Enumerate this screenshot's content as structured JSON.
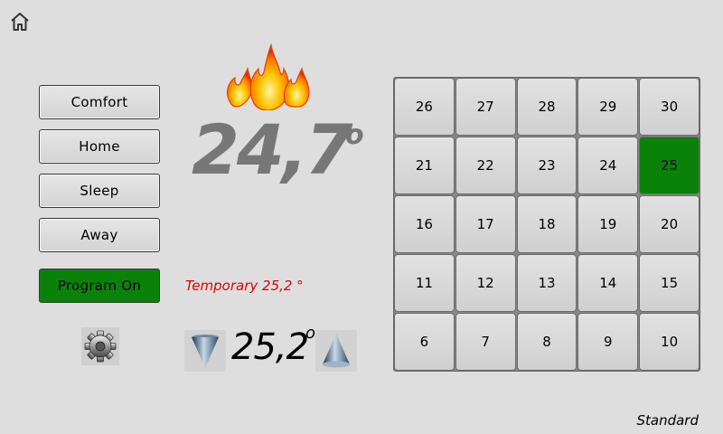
{
  "header": {
    "home_icon": "home-icon"
  },
  "modes": {
    "comfort": "Comfort",
    "home": "Home",
    "sleep": "Sleep",
    "away": "Away",
    "program": "Program On"
  },
  "status": {
    "heating_icon": "flame-icon",
    "current_temp": "24,7",
    "degree_symbol": "o",
    "temporary": "Temporary 25,2 °"
  },
  "setpoint": {
    "value": "25,2",
    "degree_symbol": "o",
    "decrease_icon": "down-cone-icon",
    "increase_icon": "up-cone-icon"
  },
  "settings": {
    "icon": "gear-icon"
  },
  "calendar": {
    "days": [
      "26",
      "27",
      "28",
      "29",
      "30",
      "21",
      "22",
      "23",
      "24",
      "25",
      "16",
      "17",
      "18",
      "19",
      "20",
      "11",
      "12",
      "13",
      "14",
      "15",
      "6",
      "7",
      "8",
      "9",
      "10"
    ],
    "selected": "25"
  },
  "footer": {
    "profile": "Standard"
  },
  "colors": {
    "active": "#0a820a",
    "temporary": "#e00000",
    "temperature": "#777777"
  }
}
